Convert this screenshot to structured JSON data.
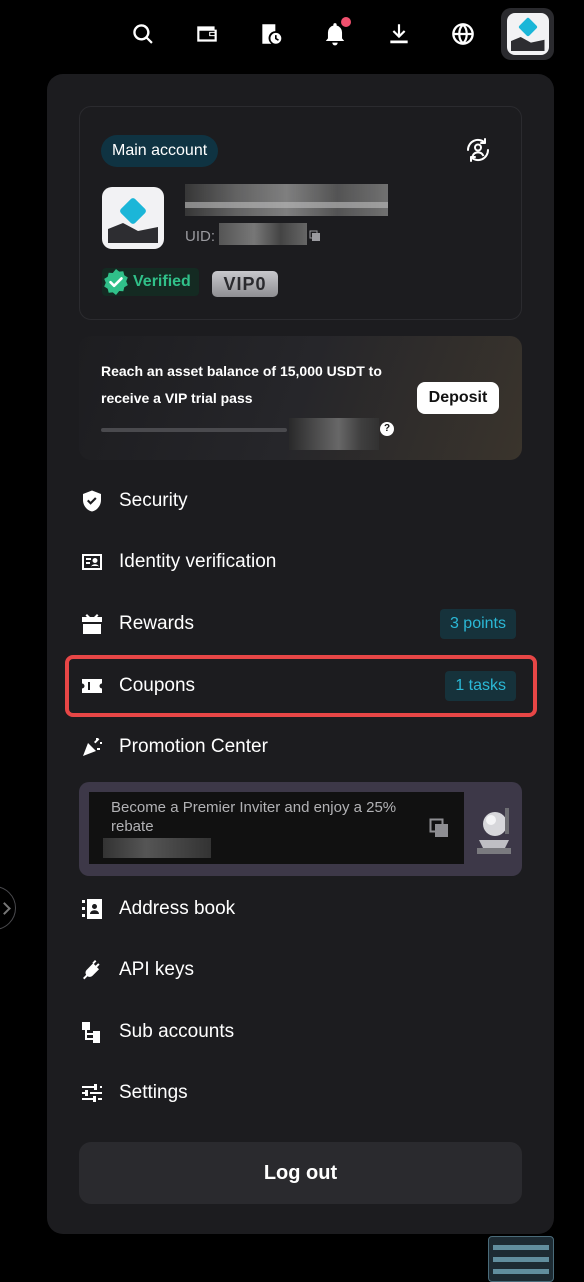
{
  "topbar": {
    "icons": [
      "search-icon",
      "wallet-icon",
      "history-icon",
      "bell-icon",
      "download-icon",
      "globe-icon",
      "avatar"
    ]
  },
  "account": {
    "badge": "Main account",
    "uid_label": "UID:",
    "verified": "Verified",
    "vip": "VIP0"
  },
  "promo": {
    "text": "Reach an asset balance of 15,000 USDT to receive a VIP trial pass",
    "deposit": "Deposit",
    "progress": 0.0,
    "help": "?"
  },
  "menu": {
    "security": "Security",
    "identity": "Identity verification",
    "rewards": "Rewards",
    "rewards_badge": "3 points",
    "coupons": "Coupons",
    "coupons_badge": "1 tasks",
    "promotion": "Promotion Center",
    "address_book": "Address book",
    "api_keys": "API keys",
    "sub_accounts": "Sub accounts",
    "settings": "Settings"
  },
  "inviter": {
    "text": "Become a Premier Inviter and enjoy a 25% rebate"
  },
  "logout": "Log out",
  "colors": {
    "accent": "#2bb8d6",
    "verified": "#30c089",
    "highlight": "#e74646",
    "panel": "#1c1c1f"
  }
}
